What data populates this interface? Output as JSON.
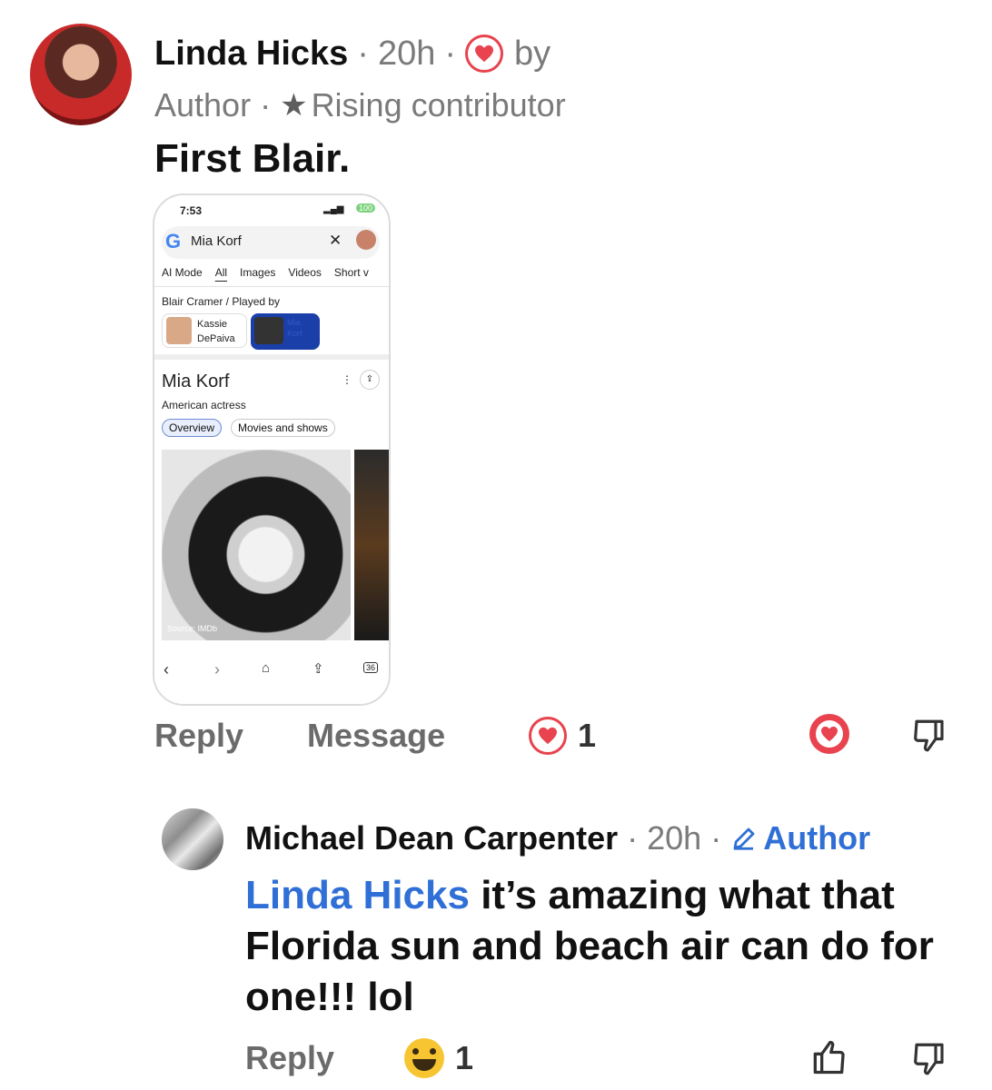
{
  "comment1": {
    "author": "Linda Hicks",
    "time": "20h",
    "reaction_suffix": "by",
    "role": "Author",
    "badge": "Rising contributor",
    "text": "First Blair.",
    "attachment": {
      "status_time": "7:53",
      "battery": "100",
      "search_query": "Mia Korf",
      "tabs": [
        "AI Mode",
        "All",
        "Images",
        "Videos",
        "Short v"
      ],
      "breadcrumb": "Blair Cramer / Played by",
      "cast": [
        "Kassie DePaiva",
        "Mia Korf"
      ],
      "entity_title": "Mia Korf",
      "entity_subtitle": "American actress",
      "chips": [
        "Overview",
        "Movies and shows"
      ],
      "image_source": "Source: IMDb",
      "tab_count": "36"
    },
    "actions": {
      "reply": "Reply",
      "message": "Message",
      "reaction_count": "1"
    }
  },
  "comment2": {
    "author": "Michael Dean Carpenter",
    "time": "20h",
    "role": "Author",
    "mention": "Linda Hicks",
    "text": " it’s amazing what that Florida sun and beach air can do for one!!! lol",
    "actions": {
      "reply": "Reply",
      "reaction_count": "1"
    }
  },
  "colors": {
    "accent_red": "#e8434e",
    "link_blue": "#2f6fd6",
    "muted": "#7a7a7a"
  }
}
